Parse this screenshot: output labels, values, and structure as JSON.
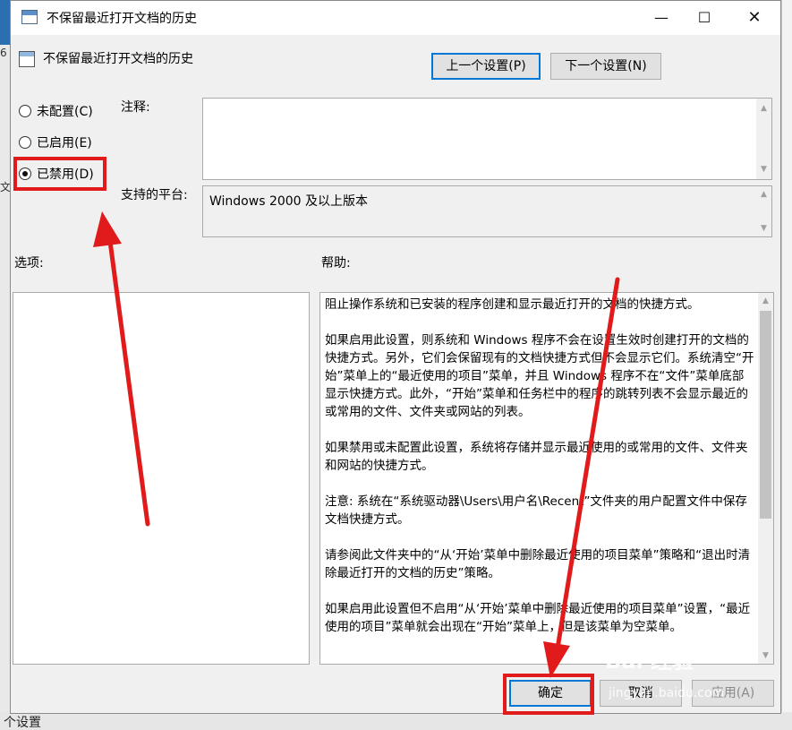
{
  "window": {
    "title": "不保留最近打开文档的历史",
    "min_glyph": "—",
    "max_glyph": "☐",
    "close_glyph": "✕"
  },
  "policy": {
    "name": "不保留最近打开文档的历史",
    "prev_button": "上一个设置(P)",
    "next_button": "下一个设置(N)"
  },
  "state": {
    "options": [
      {
        "label": "未配置(C)",
        "checked": false
      },
      {
        "label": "已启用(E)",
        "checked": false
      },
      {
        "label": "已禁用(D)",
        "checked": true
      }
    ]
  },
  "comment": {
    "label": "注释:",
    "value": ""
  },
  "platform": {
    "label": "支持的平台:",
    "value": "Windows 2000 及以上版本"
  },
  "sections": {
    "options_label": "选项:",
    "help_label": "帮助:"
  },
  "help": {
    "paragraphs": [
      "阻止操作系统和已安装的程序创建和显示最近打开的文档的快捷方式。",
      "如果启用此设置，则系统和 Windows 程序不会在设置生效时创建打开的文档的快捷方式。另外，它们会保留现有的文档快捷方式但不会显示它们。系统清空“开始”菜单上的“最近使用的项目”菜单，并且 Windows 程序不在“文件”菜单底部显示快捷方式。此外，“开始”菜单和任务栏中的程序的跳转列表不会显示最近的或常用的文件、文件夹或网站的列表。",
      "如果禁用或未配置此设置，系统将存储并显示最近使用的或常用的文件、文件夹和网站的快捷方式。",
      "注意: 系统在“系统驱动器\\Users\\用户名\\Recent”文件夹的用户配置文件中保存文档快捷方式。",
      "请参阅此文件夹中的“从‘开始’菜单中删除最近使用的项目菜单”策略和“退出时清除最近打开的文档的历史”策略。",
      "如果启用此设置但不启用“从‘开始’菜单中删除最近使用的项目菜单”设置，“最近使用的项目”菜单就会出现在“开始”菜单上，但是该菜单为空菜单。"
    ]
  },
  "footer": {
    "ok": "确定",
    "cancel": "取消",
    "apply": "应用(A)"
  },
  "background": {
    "left_marks": [
      "6",
      "文"
    ],
    "bottom_text": "个设置"
  },
  "watermark": {
    "brand": "Bai 经验",
    "url": "jingyan.baidu.com"
  },
  "colors": {
    "annotation": "#e11b1b",
    "focus_border": "#0078d7"
  }
}
